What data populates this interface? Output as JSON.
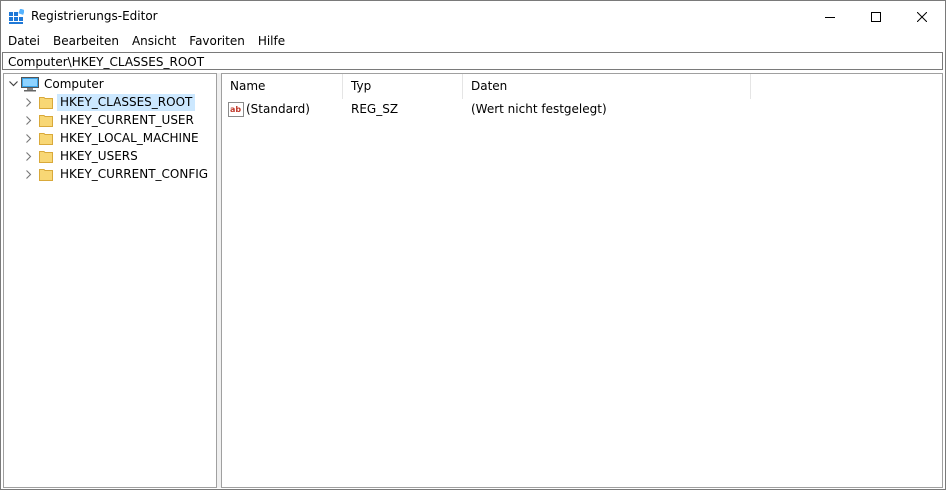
{
  "window": {
    "title": "Registrierungs-Editor",
    "icon": "regedit-icon"
  },
  "menu": {
    "items": [
      {
        "label": "Datei"
      },
      {
        "label": "Bearbeiten"
      },
      {
        "label": "Ansicht"
      },
      {
        "label": "Favoriten"
      },
      {
        "label": "Hilfe"
      }
    ]
  },
  "address": {
    "path": "Computer\\HKEY_CLASSES_ROOT"
  },
  "tree": {
    "root": {
      "label": "Computer",
      "icon": "computer-icon",
      "expanded": true
    },
    "items": [
      {
        "label": "HKEY_CLASSES_ROOT",
        "icon": "folder-icon",
        "selected": true
      },
      {
        "label": "HKEY_CURRENT_USER",
        "icon": "folder-icon",
        "selected": false
      },
      {
        "label": "HKEY_LOCAL_MACHINE",
        "icon": "folder-icon",
        "selected": false
      },
      {
        "label": "HKEY_USERS",
        "icon": "folder-icon",
        "selected": false
      },
      {
        "label": "HKEY_CURRENT_CONFIG",
        "icon": "folder-icon",
        "selected": false
      }
    ]
  },
  "list": {
    "columns": [
      {
        "label": "Name"
      },
      {
        "label": "Typ"
      },
      {
        "label": "Daten"
      }
    ],
    "rows": [
      {
        "name": "(Standard)",
        "type": "REG_SZ",
        "data": "(Wert nicht festgelegt)",
        "icon": "string-value-icon"
      }
    ]
  },
  "colors": {
    "selection": "#cce8ff",
    "folder": "#f8d775",
    "string_icon": "#c0392b"
  }
}
